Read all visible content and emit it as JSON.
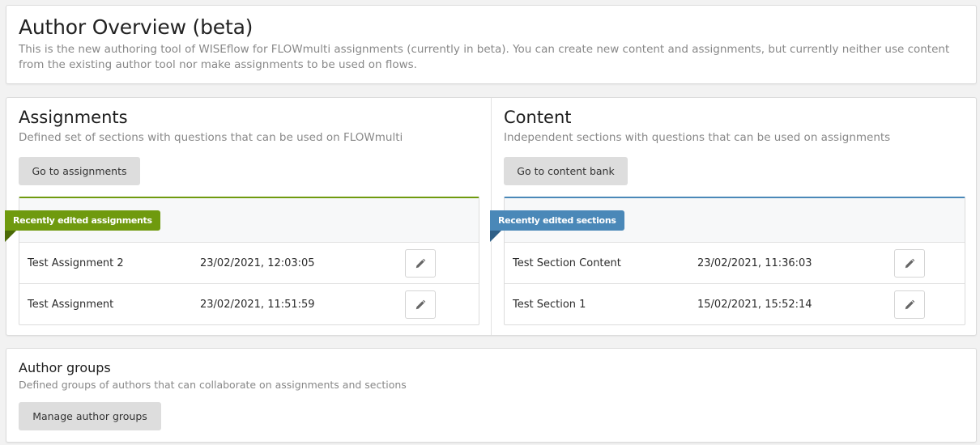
{
  "intro": {
    "title": "Author Overview (beta)",
    "description": "This is the new authoring tool of WISEflow for FLOWmulti assignments (currently in beta). You can create new content and assignments, but currently neither use content from the existing author tool nor make assignments to be used on flows."
  },
  "assignments": {
    "title": "Assignments",
    "description": "Defined set of sections with questions that can be used on FLOWmulti",
    "button_label": "Go to assignments",
    "recent_label": "Recently edited assignments",
    "rows": [
      {
        "name": "Test Assignment 2",
        "date": "23/02/2021, 12:03:05"
      },
      {
        "name": "Test Assignment",
        "date": "23/02/2021, 11:51:59"
      }
    ]
  },
  "content": {
    "title": "Content",
    "description": "Independent sections with questions that can be used on assignments",
    "button_label": "Go to content bank",
    "recent_label": "Recently edited sections",
    "rows": [
      {
        "name": "Test Section Content",
        "date": "23/02/2021, 11:36:03"
      },
      {
        "name": "Test Section 1",
        "date": "15/02/2021, 15:52:14"
      }
    ]
  },
  "author_groups": {
    "title": "Author groups",
    "description": "Defined groups of authors that can collaborate on assignments and sections",
    "button_label": "Manage author groups"
  },
  "icons": {
    "edit": "pencil-icon"
  },
  "colors": {
    "assignments_accent": "#6f9a0e",
    "content_accent": "#4a88b8",
    "button_bg": "#dddddd"
  }
}
